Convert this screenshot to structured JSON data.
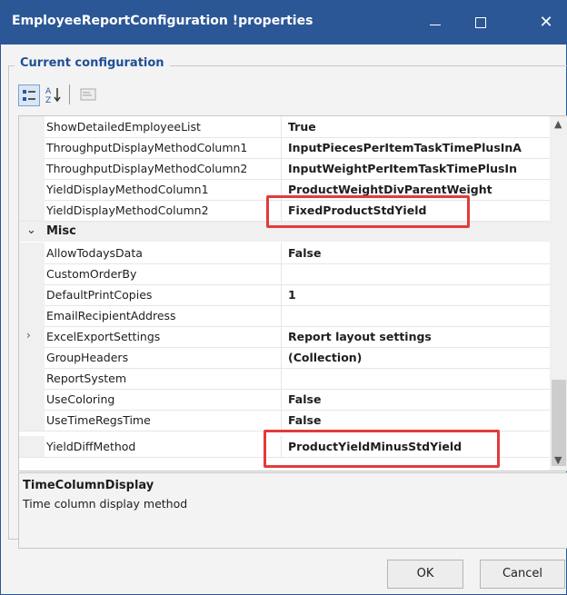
{
  "window": {
    "title": "EmployeeReportConfiguration !properties",
    "minimize": "—",
    "maximize": "□",
    "close": "✕"
  },
  "group": {
    "legend": "Current configuration"
  },
  "toolbar": {
    "categorized_icon": "categorized-view-icon",
    "alphabetical_icon": "sort-alphabetical-icon",
    "pages_icon": "property-pages-icon"
  },
  "rows_top": [
    {
      "name": "ShowDetailedEmployeeList",
      "value": "True"
    },
    {
      "name": "ThroughputDisplayMethodColumn1",
      "value": "InputPiecesPerItemTaskTimePlusInA"
    },
    {
      "name": "ThroughputDisplayMethodColumn2",
      "value": "InputWeightPerItemTaskTimePlusIn"
    },
    {
      "name": "YieldDisplayMethodColumn1",
      "value": "ProductWeightDivParentWeight"
    },
    {
      "name": "YieldDisplayMethodColumn2",
      "value": "FixedProductStdYield"
    }
  ],
  "category": {
    "name": "Misc"
  },
  "rows_misc": [
    {
      "name": "AllowTodaysData",
      "value": "False"
    },
    {
      "name": "CustomOrderBy",
      "value": ""
    },
    {
      "name": "DefaultPrintCopies",
      "value": "1"
    },
    {
      "name": "EmailRecipientAddress",
      "value": ""
    },
    {
      "name": "ExcelExportSettings",
      "value": "Report layout settings"
    },
    {
      "name": "GroupHeaders",
      "value": "(Collection)"
    },
    {
      "name": "ReportSystem",
      "value": ""
    },
    {
      "name": "UseColoring",
      "value": "False"
    },
    {
      "name": "UseTimeRegsTime",
      "value": "False"
    },
    {
      "name": "YieldDiffMethod",
      "value": "ProductYieldMinusStdYield"
    }
  ],
  "help": {
    "title": "TimeColumnDisplay",
    "description": "Time column display method"
  },
  "buttons": {
    "ok": "OK",
    "cancel": "Cancel"
  },
  "colors": {
    "titlebar": "#2b5797",
    "highlight": "#e23b3b",
    "legend": "#1f4e96"
  }
}
